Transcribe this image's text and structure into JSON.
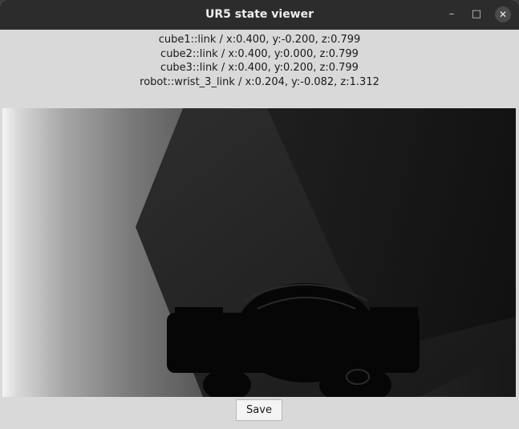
{
  "window": {
    "title": "UR5 state viewer",
    "controls": {
      "minimize": "–",
      "maximize": "□",
      "close": "✕"
    }
  },
  "state": {
    "lines": [
      "cube1::link / x:0.400, y:-0.200, z:0.799",
      "cube2::link / x:0.400, y:0.000, z:0.799",
      "cube3::link / x:0.400, y:0.200, z:0.799",
      "robot::wrist_3_link / x:0.204, y:-0.082, z:1.312"
    ]
  },
  "viewport": {
    "content": "depth-camera-render",
    "colors": {
      "background": "#111111",
      "wall_light": "#f2f2f2",
      "wall_dark": "#222222",
      "table": "#2a2a2a",
      "robot": "#050505"
    }
  },
  "actions": {
    "save_label": "Save"
  }
}
